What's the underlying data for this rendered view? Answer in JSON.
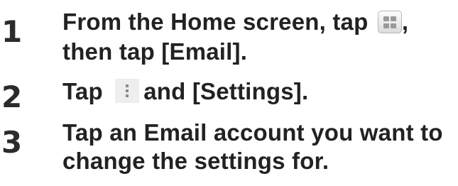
{
  "steps": [
    {
      "number": "1",
      "line1_before_icon": "From the Home screen, tap ",
      "line1_after_icon": ",",
      "line2": "then tap [Email]."
    },
    {
      "number": "2",
      "before_icon": "Tap ",
      "after_icon": "and [Settings]."
    },
    {
      "number": "3",
      "line1": "Tap an Email account you want to",
      "line2": "change the settings for."
    }
  ],
  "icons": {
    "step1": "apps-icon",
    "step2": "menu-icon"
  }
}
